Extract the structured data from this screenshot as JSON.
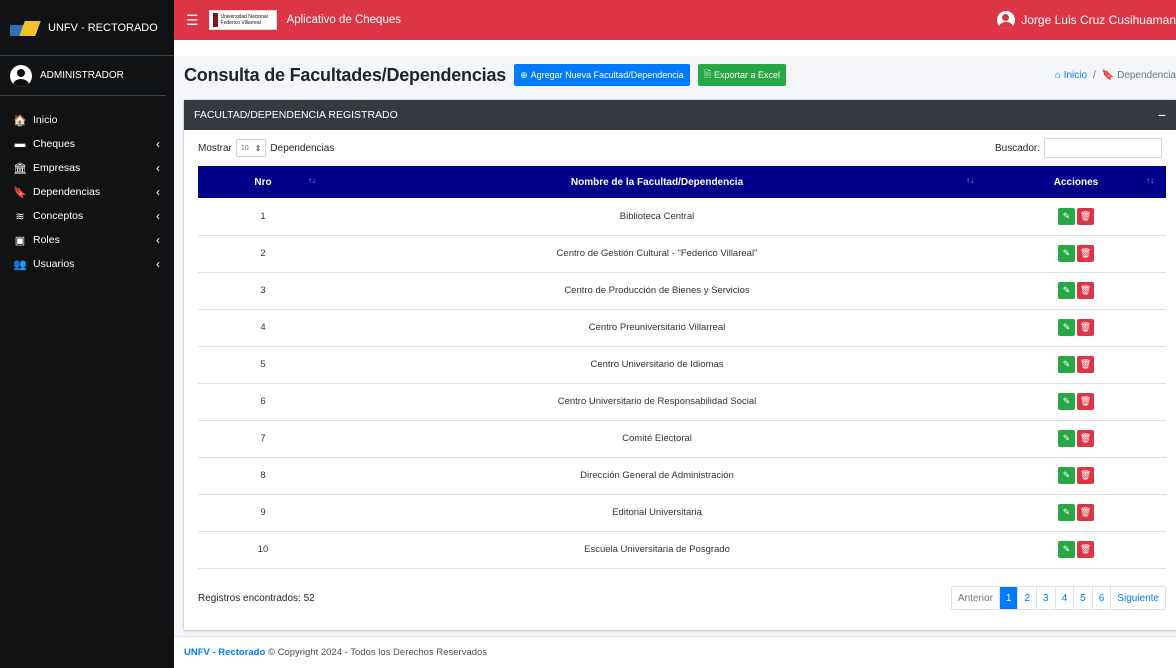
{
  "brand": {
    "title": "UNFV - RECTORADO"
  },
  "user_panel": {
    "name": "ADMINISTRADOR"
  },
  "sidebar": {
    "items": [
      {
        "label": "Inicio",
        "icon": "home-icon",
        "glyph": "🏠",
        "has_children": false
      },
      {
        "label": "Cheques",
        "icon": "check-card-icon",
        "glyph": "▬",
        "has_children": true
      },
      {
        "label": "Empresas",
        "icon": "bank-icon",
        "glyph": "🏛",
        "has_children": true
      },
      {
        "label": "Dependencias",
        "icon": "bookmark-icon",
        "glyph": "🔖",
        "has_children": true
      },
      {
        "label": "Conceptos",
        "icon": "layers-icon",
        "glyph": "≋",
        "has_children": true
      },
      {
        "label": "Roles",
        "icon": "id-card-icon",
        "glyph": "▣",
        "has_children": true
      },
      {
        "label": "Usuarios",
        "icon": "users-icon",
        "glyph": "👥",
        "has_children": true
      }
    ],
    "chevron": "‹"
  },
  "topbar": {
    "logo_text": "Universidad Nacional Federico Villarreal",
    "app_name": "Aplicativo de Cheques",
    "user_name": "Jorge Luis Cruz Cusihuaman"
  },
  "header": {
    "title": "Consulta de Facultades/Dependencias",
    "add_button": "Agregar Nueva Facultad/Dependencia",
    "export_button": "Exportar a Excel",
    "breadcrumb_home": "Inicio",
    "breadcrumb_sep": "/",
    "breadcrumb_current": "Dependencia"
  },
  "card": {
    "title": "FACULTAD/DEPENDENCIA REGISTRADO",
    "show_label": "Mostrar",
    "show_value": "10",
    "show_suffix": "Dependencias",
    "search_label": "Buscador:",
    "search_value": ""
  },
  "table": {
    "columns": [
      "Nro",
      "Nombre de la Facultad/Dependencia",
      "Acciones"
    ],
    "rows": [
      {
        "nro": "1",
        "name": "Biblioteca Central"
      },
      {
        "nro": "2",
        "name": "Centro de Gestión Cultural - \"Federico Villareal\""
      },
      {
        "nro": "3",
        "name": "Centro de Producción de Bienes y Servicios"
      },
      {
        "nro": "4",
        "name": "Centro Preuniversitario Villarreal"
      },
      {
        "nro": "5",
        "name": "Centro Universitario de Idiomas"
      },
      {
        "nro": "6",
        "name": "Centro Universitario de Responsabilidad Social"
      },
      {
        "nro": "7",
        "name": "Comité Electoral"
      },
      {
        "nro": "8",
        "name": "Dirección General de Administración"
      },
      {
        "nro": "9",
        "name": "Editorial Universitaria"
      },
      {
        "nro": "10",
        "name": "Escuela Universitaria de Posgrado"
      }
    ]
  },
  "footer_info": {
    "records": "Registros encontrados: 52",
    "pagination": [
      "Anterior",
      "1",
      "2",
      "3",
      "4",
      "5",
      "6",
      "Siguiente"
    ],
    "active_page": "1"
  },
  "footer": {
    "link": "UNFV - Rectorado",
    "text": "© Copyright 2024 - Todos los Derechos Reservados"
  },
  "colors": {
    "topbar": "#dc3545",
    "sidebar": "#111214",
    "table_header": "#00008b",
    "primary": "#007bff",
    "success": "#28a745",
    "danger": "#dc3545"
  }
}
